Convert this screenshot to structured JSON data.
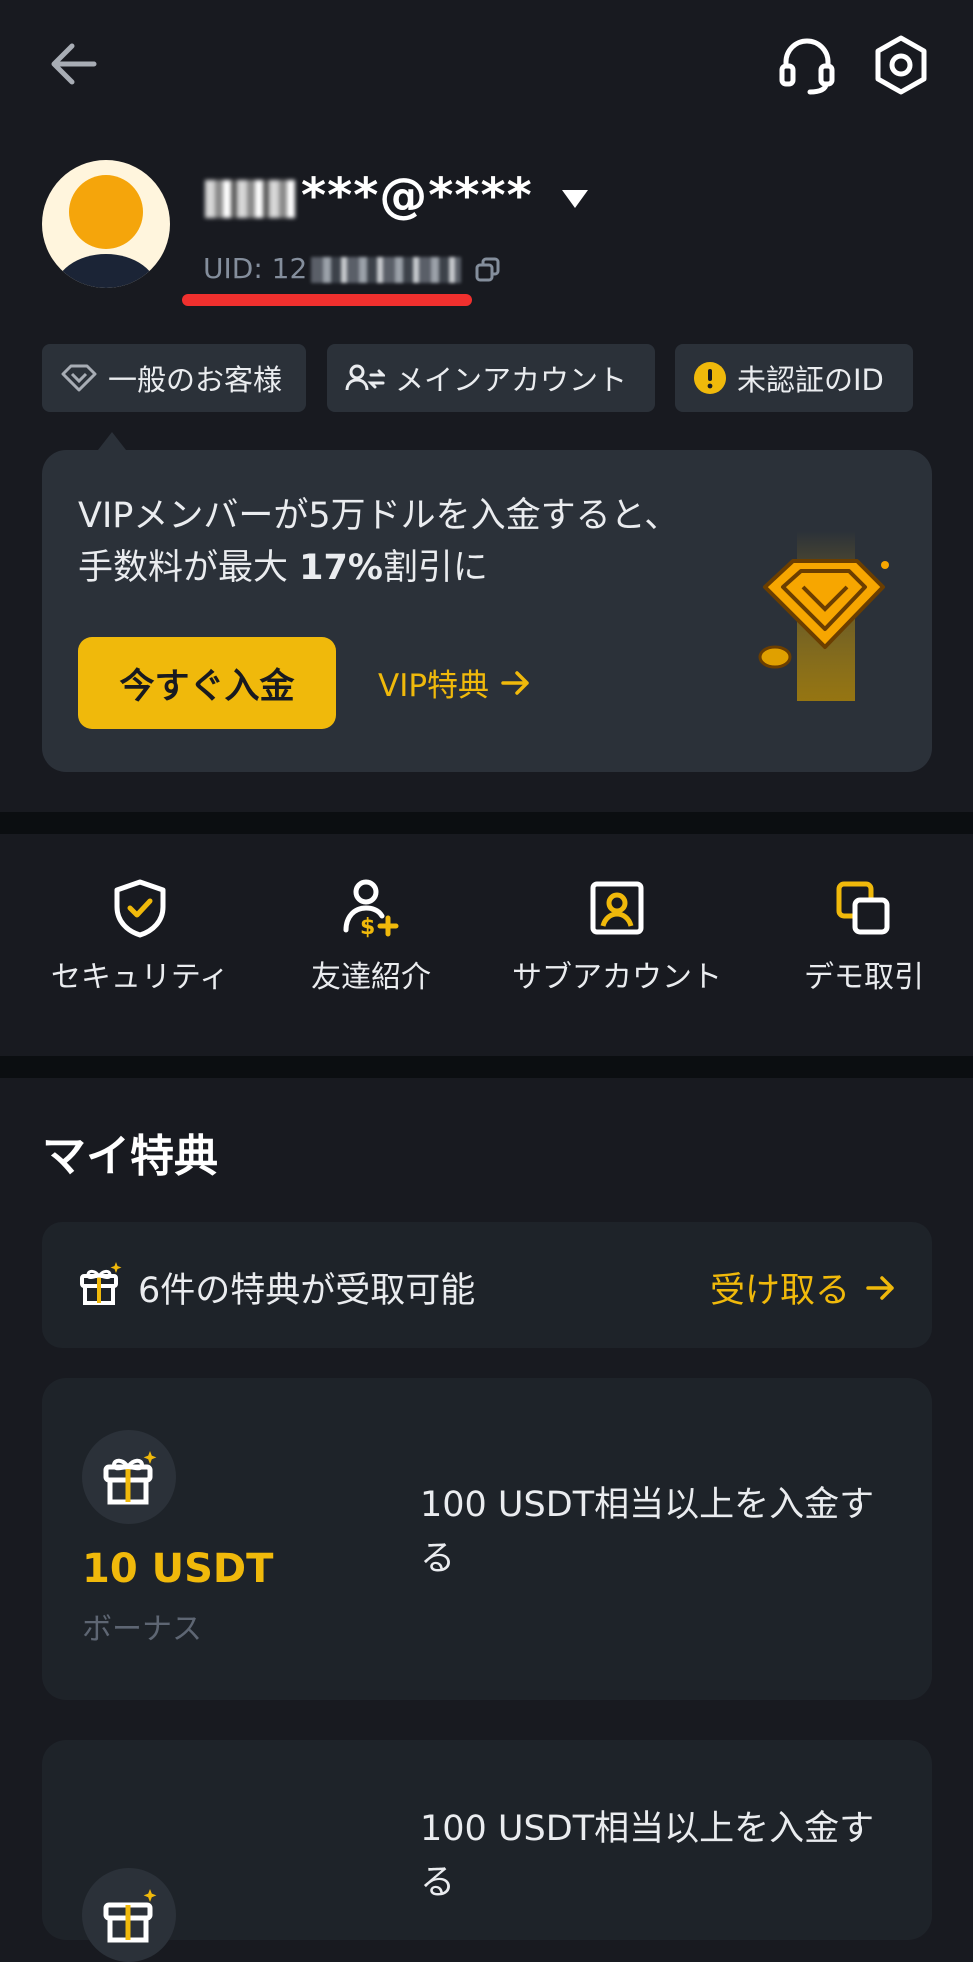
{
  "header": {
    "back_icon": "arrow-left-icon",
    "support_icon": "headset-icon",
    "settings_icon": "hexagon-gear-icon"
  },
  "profile": {
    "email_visible": "***@****",
    "uid_label": "UID: 12"
  },
  "chips": [
    {
      "label": "一般のお客様",
      "icon": "diamond-icon"
    },
    {
      "label": "メインアカウント",
      "icon": "account-switch-icon"
    },
    {
      "label": "未認証のID",
      "icon": "warning-icon"
    }
  ],
  "vip": {
    "line1": "VIPメンバーが5万ドルを入金すると、",
    "line2_a": "手数料が最大 ",
    "line2_b": "17%",
    "line2_c": "割引に",
    "deposit_button": "今すぐ入金",
    "link_label": "VIP特典"
  },
  "quick_actions": [
    {
      "label": "セキュリティ",
      "icon": "shield-check-icon"
    },
    {
      "label": "友達紹介",
      "icon": "referral-icon"
    },
    {
      "label": "サブアカウント",
      "icon": "sub-account-icon"
    },
    {
      "label": "デモ取引",
      "icon": "demo-trading-icon"
    }
  ],
  "rewards": {
    "title": "マイ特典",
    "claim_text": "6件の特典が受取可能",
    "claim_link": "受け取る",
    "cards": [
      {
        "amount": "10 USDT",
        "type": "ボーナス",
        "condition": "100 USDT相当以上を入金す\nる"
      },
      {
        "condition": "100 USDT相当以上を入金す\nる"
      }
    ]
  },
  "colors": {
    "accent": "#F0B90B",
    "background": "#181A20",
    "card": "#2B3139",
    "highlight_red": "#F0302E"
  }
}
